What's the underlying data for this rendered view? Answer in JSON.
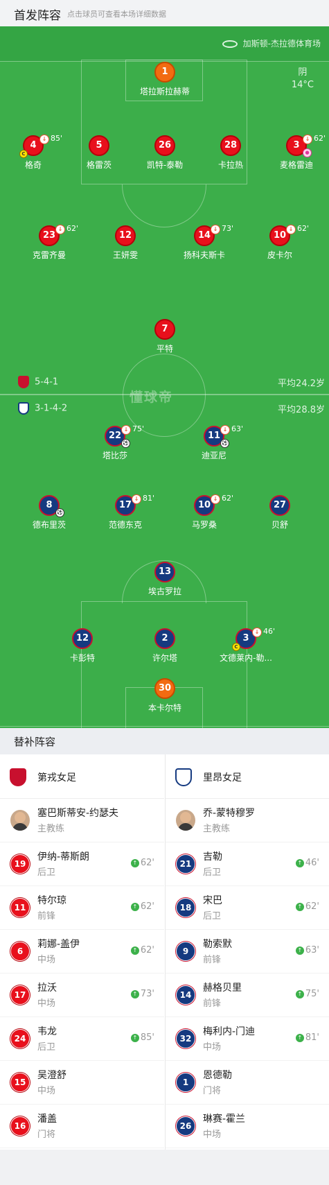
{
  "header": {
    "title": "首发阵容",
    "subtitle": "点击球员可查看本场详细数据"
  },
  "pitch": {
    "stadium": "加斯顿-杰拉德体育场",
    "weather": {
      "condition": "阴",
      "temp": "14°C"
    },
    "home_formation": "5-4-1",
    "home_avg_age": "平均24.2岁",
    "away_formation": "3-1-4-2",
    "away_avg_age": "平均28.8岁",
    "watermark": "懂球帝",
    "home_players": [
      {
        "num": "1",
        "name": "塔拉斯拉赫蒂"
      },
      {
        "num": "4",
        "name": "格奇",
        "sub_min": "85'",
        "captain": "C"
      },
      {
        "num": "5",
        "name": "格雷茨"
      },
      {
        "num": "26",
        "name": "凯特-泰勒"
      },
      {
        "num": "28",
        "name": "卡拉热"
      },
      {
        "num": "3",
        "name": "麦格雷迪",
        "sub_min": "62'"
      },
      {
        "num": "23",
        "name": "克雷齐曼",
        "sub_min": "62'"
      },
      {
        "num": "12",
        "name": "王妍雯"
      },
      {
        "num": "14",
        "name": "扬科夫斯卡",
        "sub_min": "73'"
      },
      {
        "num": "10",
        "name": "皮卡尔",
        "sub_min": "62'"
      },
      {
        "num": "7",
        "name": "平特"
      }
    ],
    "away_players": [
      {
        "num": "22",
        "name": "塔比莎",
        "sub_min": "75'"
      },
      {
        "num": "11",
        "name": "迪亚尼",
        "sub_min": "63'"
      },
      {
        "num": "8",
        "name": "德布里茨"
      },
      {
        "num": "17",
        "name": "范德东克",
        "sub_min": "81'"
      },
      {
        "num": "10",
        "name": "马罗桑",
        "sub_min": "62'"
      },
      {
        "num": "27",
        "name": "贝舒"
      },
      {
        "num": "13",
        "name": "埃古罗拉"
      },
      {
        "num": "12",
        "name": "卡彭特"
      },
      {
        "num": "2",
        "name": "许尔塔"
      },
      {
        "num": "3",
        "name": "文德莱内-勒...",
        "sub_min": "46'",
        "captain": "C"
      },
      {
        "num": "30",
        "name": "本卡尔特"
      }
    ]
  },
  "subs_header": "替补阵容",
  "home_team": {
    "name": "第戎女足",
    "coach": {
      "name": "塞巴斯蒂安-约瑟夫",
      "role": "主教练"
    },
    "subs": [
      {
        "num": "19",
        "name": "伊纳-蒂斯朗",
        "pos": "后卫",
        "min": "62'"
      },
      {
        "num": "11",
        "name": "特尔琼",
        "pos": "前锋",
        "min": "62'"
      },
      {
        "num": "6",
        "name": "莉娜-盖伊",
        "pos": "中场",
        "min": "62'"
      },
      {
        "num": "17",
        "name": "拉沃",
        "pos": "中场",
        "min": "73'"
      },
      {
        "num": "24",
        "name": "韦龙",
        "pos": "后卫",
        "min": "85'"
      },
      {
        "num": "15",
        "name": "吴澄舒",
        "pos": "中场",
        "min": ""
      },
      {
        "num": "16",
        "name": "潘盖",
        "pos": "门将",
        "min": ""
      }
    ]
  },
  "away_team": {
    "name": "里昂女足",
    "coach": {
      "name": "乔-蒙特穆罗",
      "role": "主教练"
    },
    "subs": [
      {
        "num": "21",
        "name": "吉勒",
        "pos": "后卫",
        "min": "46'"
      },
      {
        "num": "18",
        "name": "宋巴",
        "pos": "后卫",
        "min": "62'"
      },
      {
        "num": "9",
        "name": "勒索默",
        "pos": "前锋",
        "min": "63'"
      },
      {
        "num": "14",
        "name": "赫格贝里",
        "pos": "前锋",
        "min": "75'"
      },
      {
        "num": "32",
        "name": "梅利内-门迪",
        "pos": "中场",
        "min": "81'"
      },
      {
        "num": "1",
        "name": "恩德勒",
        "pos": "门将",
        "min": ""
      },
      {
        "num": "26",
        "name": "琳赛-霍兰",
        "pos": "中场",
        "min": ""
      }
    ]
  },
  "colors": {
    "pitch": "#3cae4a",
    "home": "#e8101c",
    "away": "#153a80",
    "gk": "#f26b11"
  }
}
